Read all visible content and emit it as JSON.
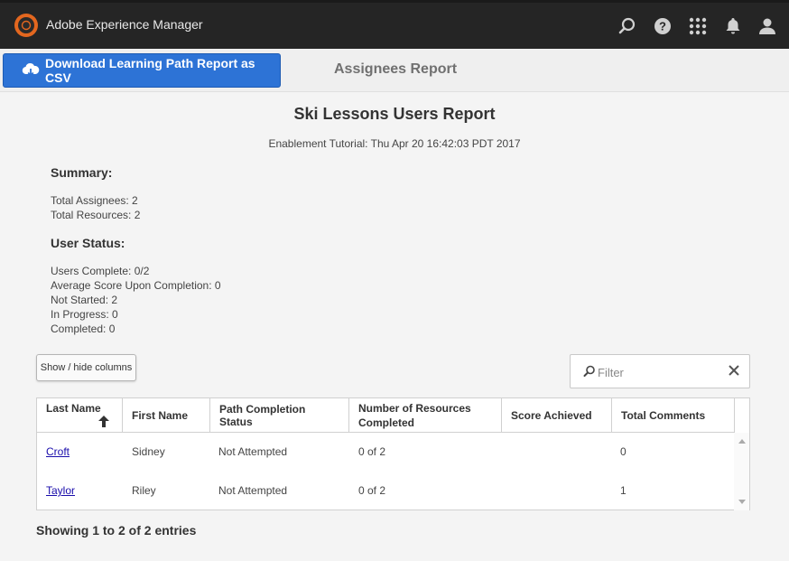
{
  "app": {
    "title": "Adobe Experience Manager"
  },
  "actions": {
    "download_label": "Download Learning Path Report as CSV",
    "report_tab": "Assignees Report"
  },
  "report": {
    "title": "Ski Lessons Users Report",
    "subtitle": "Enablement Tutorial: Thu Apr 20 16:42:03 PDT 2017"
  },
  "summary": {
    "heading": "Summary:",
    "total_assignees": "Total Assignees: 2",
    "total_resources": "Total Resources: 2"
  },
  "user_status": {
    "heading": "User Status:",
    "users_complete": "Users Complete: 0/2",
    "avg_score": "Average Score Upon Completion: 0",
    "not_started": "Not Started: 2",
    "in_progress": "In Progress: 0",
    "completed": "Completed: 0"
  },
  "controls": {
    "columns_button": "Show / hide columns",
    "filter_placeholder": "Filter"
  },
  "table": {
    "headers": {
      "last_name": "Last Name",
      "first_name": "First Name",
      "path_status": "Path Completion Status",
      "resources": "Number of Resources Completed",
      "score": "Score Achieved",
      "comments": "Total Comments"
    },
    "rows": [
      {
        "last_name": "Croft",
        "first_name": "Sidney",
        "status": "Not Attempted",
        "resources": "0 of 2",
        "score": "",
        "comments": "0"
      },
      {
        "last_name": "Taylor",
        "first_name": "Riley",
        "status": "Not Attempted",
        "resources": "0 of 2",
        "score": "",
        "comments": "1"
      }
    ],
    "footer": "Showing 1 to 2 of 2 entries"
  },
  "icons": {
    "logo": "adobe-logo-icon",
    "search": "search-icon",
    "help": "help-icon",
    "apps": "apps-grid-icon",
    "notifications": "bell-icon",
    "user": "user-icon",
    "download": "cloud-download-icon",
    "filter": "search-icon",
    "clear": "close-icon",
    "sort": "sort-up-icon"
  },
  "colors": {
    "topbar": "#252525",
    "accent": "#2d73d6",
    "logo": "#e3671f",
    "link": "#1a0dab"
  }
}
